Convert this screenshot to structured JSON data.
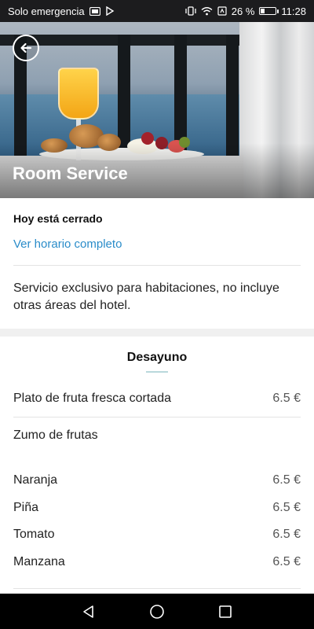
{
  "status_bar": {
    "carrier": "Solo emergencia",
    "battery_percent": "26 %",
    "time": "11:28",
    "battery_level": 0.26,
    "icons": [
      "sim-icon",
      "data-icon",
      "vibrate-icon",
      "wifi-icon",
      "signal-icon",
      "battery-icon"
    ]
  },
  "hero": {
    "title": "Room Service",
    "back_icon": "back-arrow-icon"
  },
  "info": {
    "status": "Hoy está cerrado",
    "hours_link": "Ver horario completo",
    "description": "Servicio exclusivo para habitaciones, no incluye otras áreas del hotel."
  },
  "menu": {
    "section_title": "Desayuno",
    "items": [
      {
        "name": "Plato de fruta fresca cortada",
        "price": "6.5 €"
      },
      {
        "name": "Zumo de frutas",
        "price": ""
      },
      {
        "name": "Naranja",
        "price": "6.5 €"
      },
      {
        "name": "Piña",
        "price": "6.5 €"
      },
      {
        "name": "Tomato",
        "price": "6.5 €"
      },
      {
        "name": "Manzana",
        "price": "6.5 €"
      }
    ]
  },
  "nav_bar": {
    "icons": [
      "nav-back-icon",
      "nav-home-icon",
      "nav-recents-icon"
    ]
  },
  "colors": {
    "link": "#2a8cc9",
    "status_bar": "#1c1c1e",
    "nav_bar": "#000000"
  }
}
